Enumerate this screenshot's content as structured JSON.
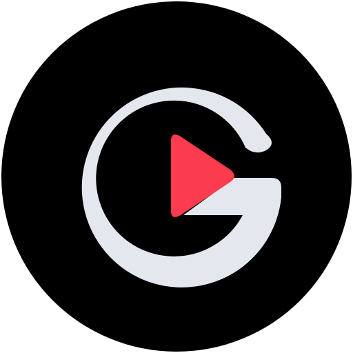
{
  "logo": {
    "name": "g-play-logo",
    "colors": {
      "background": "#ffffff",
      "disc": "#000000",
      "letter": "#e4e7ee",
      "play": "#fb3b4e"
    },
    "icons": {
      "letter": "letter-g-icon",
      "play": "play-icon"
    }
  }
}
